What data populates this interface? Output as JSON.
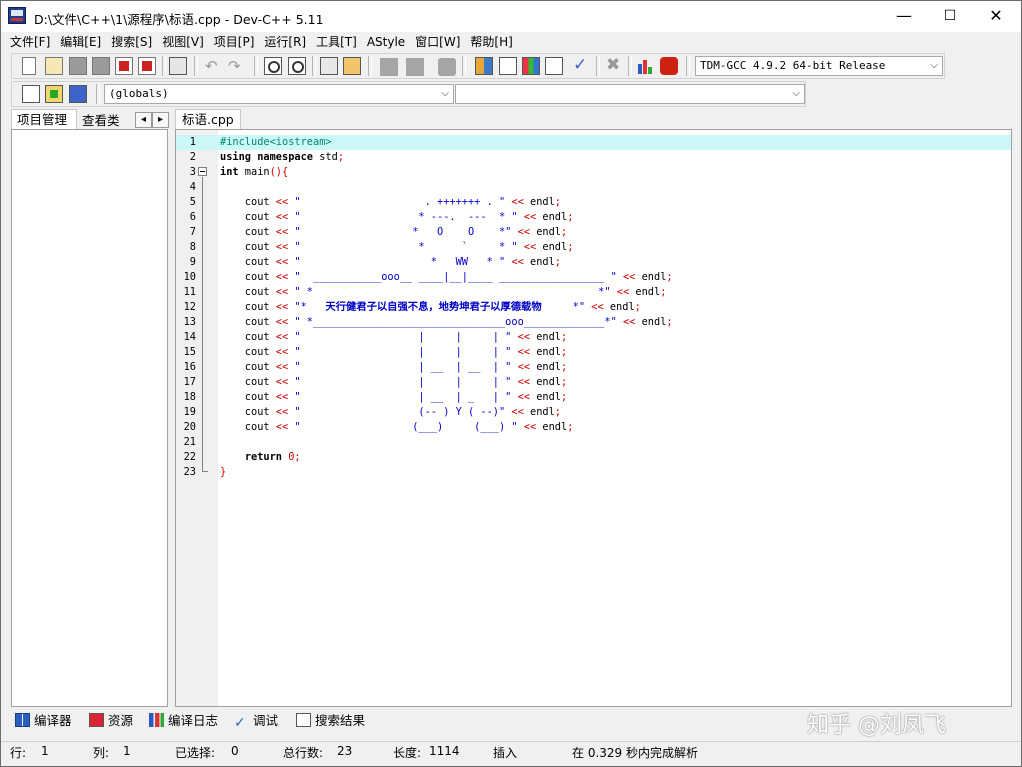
{
  "window": {
    "title": "D:\\文件\\C++\\1\\源程序\\标语.cpp - Dev-C++ 5.11",
    "minimize": "—",
    "maximize": "☐",
    "close": "✕"
  },
  "menu": [
    "文件[F]",
    "编辑[E]",
    "搜索[S]",
    "视图[V]",
    "项目[P]",
    "运行[R]",
    "工具[T]",
    "AStyle",
    "窗口[W]",
    "帮助[H]"
  ],
  "toolbar": {
    "compiler_select": "TDM-GCC 4.9.2 64-bit Release",
    "scope_select": "(globals)",
    "member_select": ""
  },
  "left_panel": {
    "tabs": [
      "项目管理",
      "查看类"
    ],
    "nav_prev": "◂",
    "nav_next": "▸"
  },
  "editor": {
    "file_tab": "标语.cpp",
    "lines": [
      {
        "n": "1",
        "html": "<span class='pp'>#include&lt;iostream&gt;</span>"
      },
      {
        "n": "2",
        "html": "<span class='kw'>using namespace</span> std<span class='op'>;</span>"
      },
      {
        "n": "3",
        "html": "<span class='kw'>int</span> main<span class='br'>(){</span>"
      },
      {
        "n": "4",
        "html": ""
      },
      {
        "n": "5",
        "html": "    cout <span class='op'>&lt;&lt;</span> <span class='str'>\"                    . +++++++ . \"</span> <span class='op'>&lt;&lt;</span> endl<span class='op'>;</span>"
      },
      {
        "n": "6",
        "html": "    cout <span class='op'>&lt;&lt;</span> <span class='str'>\"                   * ---.  ---  * \"</span> <span class='op'>&lt;&lt;</span> endl<span class='op'>;</span>"
      },
      {
        "n": "7",
        "html": "    cout <span class='op'>&lt;&lt;</span> <span class='str'>\"                  *   O    O    *\"</span> <span class='op'>&lt;&lt;</span> endl<span class='op'>;</span>"
      },
      {
        "n": "8",
        "html": "    cout <span class='op'>&lt;&lt;</span> <span class='str'>\"                   *      `     * \"</span> <span class='op'>&lt;&lt;</span> endl<span class='op'>;</span>"
      },
      {
        "n": "9",
        "html": "    cout <span class='op'>&lt;&lt;</span> <span class='str'>\"                     *   WW   * \"</span> <span class='op'>&lt;&lt;</span> endl<span class='op'>;</span>"
      },
      {
        "n": "10",
        "html": "    cout <span class='op'>&lt;&lt;</span> <span class='str'>\"  ___________ooo__ ____|__|____ _________________ \"</span> <span class='op'>&lt;&lt;</span> endl<span class='op'>;</span>"
      },
      {
        "n": "11",
        "html": "    cout <span class='op'>&lt;&lt;</span> <span class='str'>\" *                                              *\"</span> <span class='op'>&lt;&lt;</span> endl<span class='op'>;</span>"
      },
      {
        "n": "12",
        "html": "    cout <span class='op'>&lt;&lt;</span> <span class='str'>\"*   <b>天行健君子以自强不息，地势坤君子以厚德载物</b>     *\"</span> <span class='op'>&lt;&lt;</span> endl<span class='op'>;</span>"
      },
      {
        "n": "13",
        "html": "    cout <span class='op'>&lt;&lt;</span> <span class='str'>\" *_______________________________ooo_____________*\"</span> <span class='op'>&lt;&lt;</span> endl<span class='op'>;</span>"
      },
      {
        "n": "14",
        "html": "    cout <span class='op'>&lt;&lt;</span> <span class='str'>\"                   |     |     | \"</span> <span class='op'>&lt;&lt;</span> endl<span class='op'>;</span>"
      },
      {
        "n": "15",
        "html": "    cout <span class='op'>&lt;&lt;</span> <span class='str'>\"                   |     |     | \"</span> <span class='op'>&lt;&lt;</span> endl<span class='op'>;</span>"
      },
      {
        "n": "16",
        "html": "    cout <span class='op'>&lt;&lt;</span> <span class='str'>\"                   | __  | __  | \"</span> <span class='op'>&lt;&lt;</span> endl<span class='op'>;</span>"
      },
      {
        "n": "17",
        "html": "    cout <span class='op'>&lt;&lt;</span> <span class='str'>\"                   |     |     | \"</span> <span class='op'>&lt;&lt;</span> endl<span class='op'>;</span>"
      },
      {
        "n": "18",
        "html": "    cout <span class='op'>&lt;&lt;</span> <span class='str'>\"                   | __  | _   | \"</span> <span class='op'>&lt;&lt;</span> endl<span class='op'>;</span>"
      },
      {
        "n": "19",
        "html": "    cout <span class='op'>&lt;&lt;</span> <span class='str'>\"                   (-- ) Y ( --)\"</span> <span class='op'>&lt;&lt;</span> endl<span class='op'>;</span>"
      },
      {
        "n": "20",
        "html": "    cout <span class='op'>&lt;&lt;</span> <span class='str'>\"                  (___)     (___) \"</span> <span class='op'>&lt;&lt;</span> endl<span class='op'>;</span>"
      },
      {
        "n": "21",
        "html": ""
      },
      {
        "n": "22",
        "html": "    <span class='kw'>return</span> <span class='num'>0</span><span class='op'>;</span>"
      },
      {
        "n": "23",
        "html": "<span class='br'>}</span>"
      }
    ]
  },
  "bottom_tabs": [
    "编译器",
    "资源",
    "编译日志",
    "调试",
    "搜索结果"
  ],
  "watermark": "知乎 @刘凤飞",
  "status": {
    "row_label": "行:",
    "row": "1",
    "col_label": "列:",
    "col": "1",
    "sel_label": "已选择:",
    "sel": "0",
    "total_label": "总行数:",
    "total": "23",
    "len_label": "长度:",
    "len": "1114",
    "mode": "插入",
    "parse": "在 0.329 秒内完成解析"
  }
}
